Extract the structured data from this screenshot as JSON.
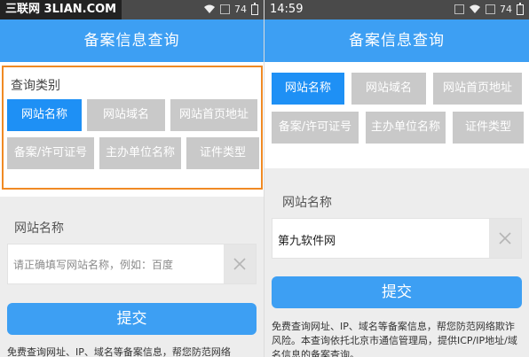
{
  "left": {
    "status": {
      "watermark": "三联网 3LIAN.COM",
      "battery": "74"
    },
    "title": "备案信息查询",
    "category_label": "查询类别",
    "categories": [
      "网站名称",
      "网站域名",
      "网站首页地址",
      "备案/许可证号",
      "主办单位名称",
      "证件类型"
    ],
    "field_label": "网站名称",
    "input_value": "",
    "input_placeholder": "请正确填写网站名称，例如：百度",
    "submit_label": "提交",
    "description": "免费查询网址、IP、域名等备案信息，帮您防范网络"
  },
  "right": {
    "status": {
      "time": "14:59",
      "battery": "74"
    },
    "title": "备案信息查询",
    "categories": [
      "网站名称",
      "网站域名",
      "网站首页地址",
      "备案/许可证号",
      "主办单位名称",
      "证件类型"
    ],
    "field_label": "网站名称",
    "input_value": "第九软件网",
    "submit_label": "提交",
    "description": "免费查询网址、IP、域名等备案信息，帮您防范网络欺诈风险。本查询依托北京市通信管理局，提供ICP/IP地址/域名信息的备案查询。"
  },
  "colors": {
    "accent": "#3d9ff3",
    "active_chip": "#1e90f5",
    "chip": "#c9c9c9",
    "highlight": "#f08a24"
  },
  "icons": {
    "clear": "close-icon",
    "wifi": "wifi-icon",
    "battery": "battery-icon"
  }
}
